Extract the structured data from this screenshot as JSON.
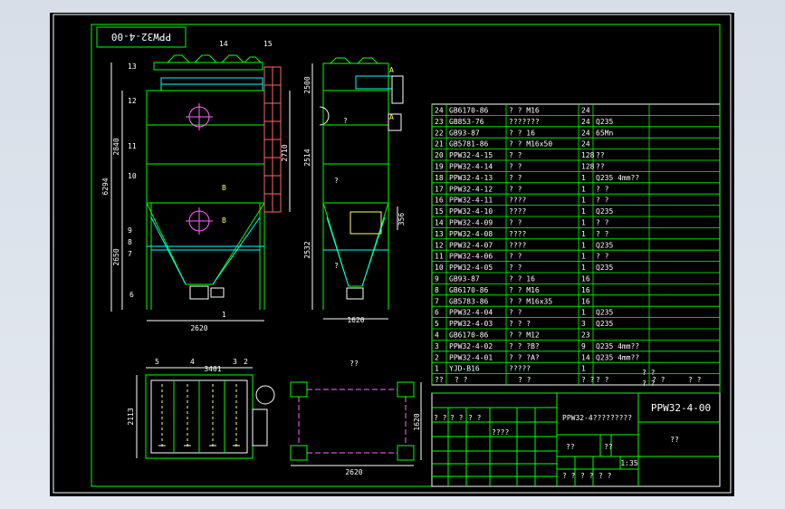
{
  "drawing": {
    "code_box": "PPW32-4-00",
    "section_label_a": "A",
    "section_label_b": "B",
    "front_view_dims": {
      "overall_height": "6294",
      "upper_height": "2840",
      "lower_height": "2650",
      "bottom_width": "2620",
      "side_height": "2710"
    },
    "side_view_dims": {
      "top": "2500",
      "mid": "2514",
      "small": "356",
      "lower": "2532",
      "bottom_width": "1620"
    },
    "plan_view_dims": {
      "width": "3401",
      "height": "2113"
    },
    "base_view": {
      "title": "??",
      "height": "1620",
      "width": "2620"
    },
    "balloons": [
      "14",
      "15",
      "13",
      "12",
      "11",
      "10",
      "9",
      "8",
      "7",
      "6",
      "1",
      "5",
      "4",
      "3",
      "2"
    ],
    "side_balloons": [
      "?",
      "?",
      "?"
    ]
  },
  "bom": {
    "rows": [
      {
        "no": "24",
        "code": "GB6170-86",
        "name": "? ? M16",
        "qty": "24",
        "mat": ""
      },
      {
        "no": "23",
        "code": "GB853-76",
        "name": "???????",
        "qty": "24",
        "mat": "Q235"
      },
      {
        "no": "22",
        "code": "GB93-87",
        "name": "? ? 16",
        "qty": "24",
        "mat": "65Mn"
      },
      {
        "no": "21",
        "code": "GB5781-86",
        "name": "? ? M16x50",
        "qty": "24",
        "mat": ""
      },
      {
        "no": "20",
        "code": "PPW32-4-15",
        "name": "? ?",
        "qty": "128",
        "mat": "??"
      },
      {
        "no": "19",
        "code": "PPW32-4-14",
        "name": "? ?",
        "qty": "128",
        "mat": "??"
      },
      {
        "no": "18",
        "code": "PPW32-4-13",
        "name": "? ?",
        "qty": "1",
        "mat": "Q235 4mm??"
      },
      {
        "no": "17",
        "code": "PPW32-4-12",
        "name": "? ?",
        "qty": "1",
        "mat": "? ?"
      },
      {
        "no": "16",
        "code": "PPW32-4-11",
        "name": "????",
        "qty": "1",
        "mat": "? ?"
      },
      {
        "no": "15",
        "code": "PPW32-4-10",
        "name": "????",
        "qty": "1",
        "mat": "Q235"
      },
      {
        "no": "14",
        "code": "PPW32-4-09",
        "name": "? ?",
        "qty": "1",
        "mat": "? ?"
      },
      {
        "no": "13",
        "code": "PPW32-4-08",
        "name": "????",
        "qty": "1",
        "mat": "? ?"
      },
      {
        "no": "12",
        "code": "PPW32-4-07",
        "name": "????",
        "qty": "1",
        "mat": "Q235"
      },
      {
        "no": "11",
        "code": "PPW32-4-06",
        "name": "? ?",
        "qty": "1",
        "mat": "? ?"
      },
      {
        "no": "10",
        "code": "PPW32-4-05",
        "name": "? ?",
        "qty": "1",
        "mat": "Q235"
      },
      {
        "no": "9",
        "code": "GB93-87",
        "name": "? ? 16",
        "qty": "16",
        "mat": ""
      },
      {
        "no": "8",
        "code": "GB6170-86",
        "name": "? ? M16",
        "qty": "16",
        "mat": ""
      },
      {
        "no": "7",
        "code": "GB5783-86",
        "name": "? ? M16x35",
        "qty": "16",
        "mat": ""
      },
      {
        "no": "6",
        "code": "PPW32-4-04",
        "name": "? ?",
        "qty": "1",
        "mat": "Q235"
      },
      {
        "no": "5",
        "code": "PPW32-4-03",
        "name": "? ? ?",
        "qty": "3",
        "mat": "Q235"
      },
      {
        "no": "4",
        "code": "GB6170-86",
        "name": "? ? M12",
        "qty": "23",
        "mat": ""
      },
      {
        "no": "3",
        "code": "PPW32-4-02",
        "name": "? ? ?B?",
        "qty": "9",
        "mat": "Q235 4mm??"
      },
      {
        "no": "2",
        "code": "PPW32-4-01",
        "name": "? ? ?A?",
        "qty": "14",
        "mat": "Q235 4mm??"
      },
      {
        "no": "1",
        "code": "YJD-B16",
        "name": "?????",
        "qty": "1",
        "mat": ""
      }
    ],
    "header": [
      "??",
      "? ?",
      "? ?",
      "? ?",
      "? ?",
      "? ?",
      "? ?"
    ]
  },
  "title_block": {
    "drawing_no": "PPW32-4-00",
    "name": "PPW32-4?????????",
    "company": "??",
    "scale": "1:35",
    "cells": [
      "? ?",
      "? ?",
      "? ?",
      "????",
      "??",
      "??",
      "? ?",
      "? ?",
      "? ?",
      "? ?",
      "? ?"
    ]
  }
}
